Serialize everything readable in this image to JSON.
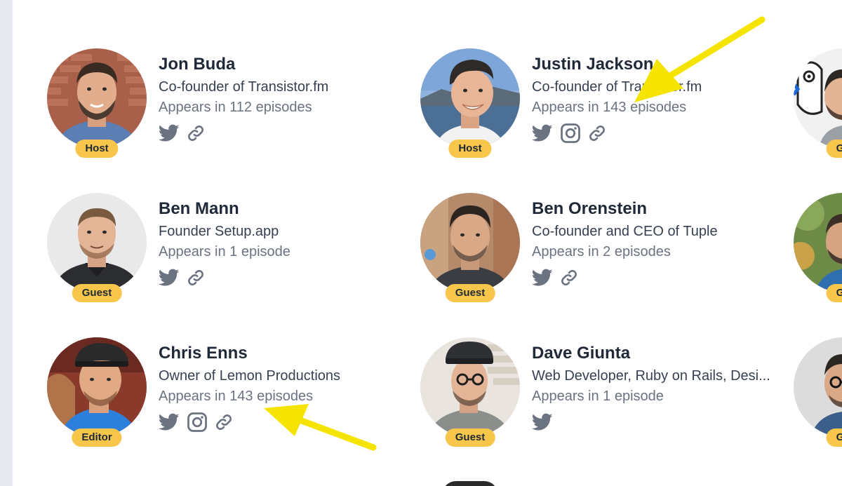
{
  "colors": {
    "badge": "#f7c64b",
    "icon": "#6b7280",
    "name": "#1f2937",
    "arrow": "#f5e300"
  },
  "people": [
    {
      "name": "Jon Buda",
      "role": "Co-founder of Transistor.fm",
      "appears": "Appears in 112 episodes",
      "badge": "Host",
      "links": [
        "twitter-icon",
        "link-icon"
      ]
    },
    {
      "name": "Justin Jackson",
      "role": "Co-founder of Transistor.fm",
      "appears": "Appears in 143 episodes",
      "badge": "Host",
      "links": [
        "twitter-icon",
        "instagram-icon",
        "link-icon"
      ]
    },
    {
      "name": "",
      "role": "",
      "appears": "",
      "badge": "Gu"
    },
    {
      "name": "Ben Mann",
      "role": "Founder Setup.app",
      "appears": "Appears in 1 episode",
      "badge": "Guest",
      "links": [
        "twitter-icon",
        "link-icon"
      ]
    },
    {
      "name": "Ben Orenstein",
      "role": "Co-founder and CEO of Tuple",
      "appears": "Appears in 2 episodes",
      "badge": "Guest",
      "links": [
        "twitter-icon",
        "link-icon"
      ]
    },
    {
      "name": "",
      "role": "",
      "appears": "",
      "badge": "Gu"
    },
    {
      "name": "Chris Enns",
      "role": "Owner of Lemon Productions",
      "appears": "Appears in 143 episodes",
      "badge": "Editor",
      "links": [
        "twitter-icon",
        "instagram-icon",
        "link-icon"
      ]
    },
    {
      "name": "Dave Giunta",
      "role": "Web Developer, Ruby on Rails, Desi...",
      "appears": "Appears in 1 episode",
      "badge": "Guest",
      "links": [
        "twitter-icon"
      ]
    },
    {
      "name": "",
      "role": "",
      "appears": "",
      "badge": "Gu"
    }
  ]
}
